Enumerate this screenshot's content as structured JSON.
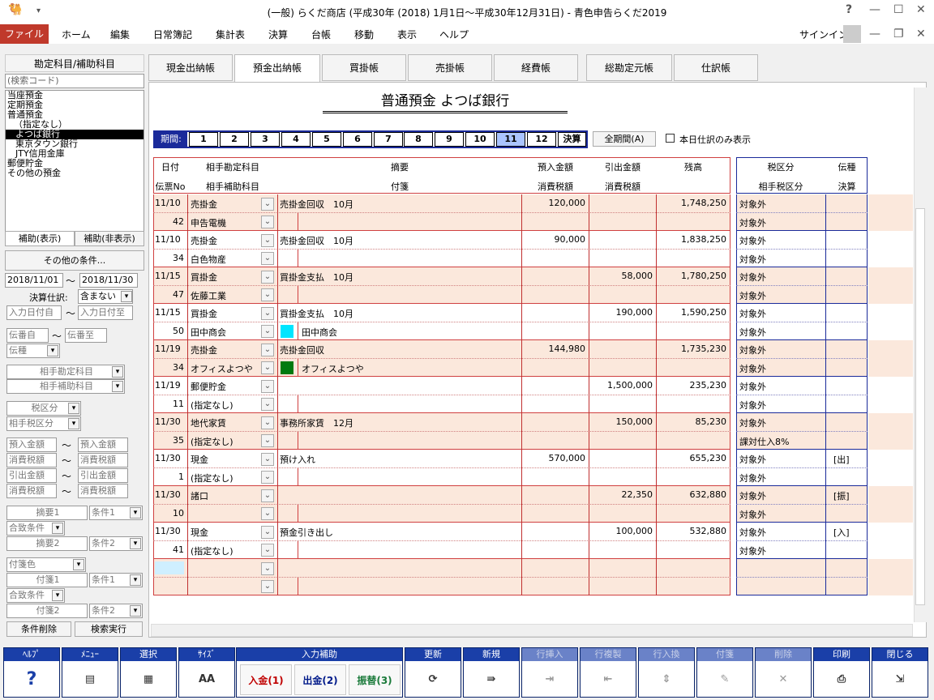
{
  "window": {
    "title": "(一般) らくだ商店 (平成30年 (2018) 1月1日〜平成30年12月31日) - 青色申告らくだ2019",
    "help_label": "?",
    "signin_label": "サインイン"
  },
  "menu": [
    "ファイル",
    "ホーム",
    "編集",
    "日常簿記",
    "集計表",
    "決算",
    "台帳",
    "移動",
    "表示",
    "ヘルプ"
  ],
  "left": {
    "header": "勘定科目/補助科目",
    "search_placeholder": "(検索コード)",
    "tree": [
      "当座預金",
      "定期預金",
      "普通預金",
      "（指定なし）",
      "よつば銀行",
      "東京タウン銀行",
      "JTY信用金庫",
      "郵便貯金",
      "その他の預金"
    ],
    "tab_show": "補助(表示)",
    "tab_hide": "補助(非表示)",
    "other_cond": "その他の条件...",
    "date_from": "2018/11/01",
    "date_to": "2018/11/30",
    "tilde": "〜",
    "kessan_label": "決算仕訳:",
    "kessan_value": "含まない",
    "input_from": "入力日付自",
    "input_to": "入力日付至",
    "denban_from": "伝番自",
    "denban_to": "伝番至",
    "denshu": "伝種",
    "aite_kamoku": "相手勘定科目",
    "aite_hojo": "相手補助科目",
    "zeikubun": "税区分",
    "aite_zei": "相手税区分",
    "azuke_from": "預入金額",
    "azuke_to": "預入金額",
    "shohi1_from": "消費税額",
    "shohi1_to": "消費税額",
    "hiki_from": "引出金額",
    "hiki_to": "引出金額",
    "shohi2_from": "消費税額",
    "shohi2_to": "消費税額",
    "tekiyo1": "摘要1",
    "joken1": "条件1",
    "goitchi1": "合致条件",
    "tekiyo2": "摘要2",
    "joken2": "条件2",
    "fusen_color": "付箋色",
    "fusen1": "付箋1",
    "fjoken1": "条件1",
    "goitchi2": "合致条件",
    "fusen2": "付箋2",
    "fjoken2": "条件2",
    "clear_btn": "条件削除",
    "search_btn": "検索実行"
  },
  "tabs": [
    "現金出納帳",
    "預金出納帳",
    "買掛帳",
    "売掛帳",
    "経費帳",
    "総勘定元帳",
    "仕訳帳"
  ],
  "ledger": {
    "title": "普通預金 よつば銀行",
    "period_label": "期間:",
    "periods": [
      "1",
      "2",
      "3",
      "4",
      "5",
      "6",
      "7",
      "8",
      "9",
      "10",
      "11",
      "12",
      "決算"
    ],
    "all_period": "全期間(A)",
    "today_only": "本日仕訳のみ表示",
    "headers": {
      "date": "日付",
      "denno": "伝票No",
      "aite": "相手勘定科目",
      "aite_hojo": "相手補助科目",
      "tekiyo": "摘要",
      "fusen": "付箋",
      "azuke": "預入金額",
      "azuke_tax": "消費税額",
      "hiki": "引出金額",
      "hiki_tax": "消費税額",
      "zandaka": "残高",
      "zei": "税区分",
      "aite_zei": "相手税区分",
      "denshu": "伝種",
      "kessan": "決算"
    },
    "rows": [
      {
        "date": "11/10",
        "no": "42",
        "kamoku": "売掛金",
        "hojo": "申告電機",
        "tekiyo": "売掛金回収　10月",
        "fusen": "",
        "azuke": "120,000",
        "hiki": "",
        "zandaka": "1,748,250",
        "zei": "対象外",
        "aite_zei": "対象外",
        "denshu": ""
      },
      {
        "date": "11/10",
        "no": "34",
        "kamoku": "売掛金",
        "hojo": "白色物産",
        "tekiyo": "売掛金回収　10月",
        "fusen": "",
        "azuke": "90,000",
        "hiki": "",
        "zandaka": "1,838,250",
        "zei": "対象外",
        "aite_zei": "対象外",
        "denshu": ""
      },
      {
        "date": "11/15",
        "no": "47",
        "kamoku": "買掛金",
        "hojo": "佐藤工業",
        "tekiyo": "買掛金支払　10月",
        "fusen": "",
        "azuke": "",
        "hiki": "58,000",
        "zandaka": "1,780,250",
        "zei": "対象外",
        "aite_zei": "対象外",
        "denshu": ""
      },
      {
        "date": "11/15",
        "no": "50",
        "kamoku": "買掛金",
        "hojo": "田中商会",
        "tekiyo": "買掛金支払　10月",
        "fusen": "田中商会",
        "fcolor": "#00e5ff",
        "azuke": "",
        "hiki": "190,000",
        "zandaka": "1,590,250",
        "zei": "対象外",
        "aite_zei": "対象外",
        "denshu": ""
      },
      {
        "date": "11/19",
        "no": "34",
        "kamoku": "売掛金",
        "hojo": "オフィスよつや",
        "tekiyo": "売掛金回収",
        "fusen": "オフィスよつや",
        "fcolor": "#007a10",
        "azuke": "144,980",
        "hiki": "",
        "zandaka": "1,735,230",
        "zei": "対象外",
        "aite_zei": "対象外",
        "denshu": ""
      },
      {
        "date": "11/19",
        "no": "11",
        "kamoku": "郵便貯金",
        "hojo": "(指定なし)",
        "tekiyo": "",
        "fusen": "",
        "azuke": "",
        "hiki": "1,500,000",
        "zandaka": "235,230",
        "zei": "対象外",
        "aite_zei": "対象外",
        "denshu": ""
      },
      {
        "date": "11/30",
        "no": "35",
        "kamoku": "地代家賃",
        "hojo": "(指定なし)",
        "tekiyo": "事務所家賃　12月",
        "fusen": "",
        "azuke": "",
        "hiki": "150,000",
        "zandaka": "85,230",
        "zei": "対象外",
        "aite_zei": "課対仕入8%",
        "denshu": ""
      },
      {
        "date": "11/30",
        "no": "1",
        "kamoku": "現金",
        "hojo": "(指定なし)",
        "tekiyo": "預け入れ",
        "fusen": "",
        "azuke": "570,000",
        "hiki": "",
        "zandaka": "655,230",
        "zei": "対象外",
        "aite_zei": "対象外",
        "denshu": "[出]"
      },
      {
        "date": "11/30",
        "no": "10",
        "kamoku": "諸口",
        "hojo": "",
        "tekiyo": "",
        "fusen": "",
        "azuke": "",
        "hiki": "22,350",
        "zandaka": "632,880",
        "zei": "対象外",
        "aite_zei": "対象外",
        "denshu": "[振]"
      },
      {
        "date": "11/30",
        "no": "41",
        "kamoku": "現金",
        "hojo": "(指定なし)",
        "tekiyo": "預金引き出し",
        "fusen": "",
        "azuke": "",
        "hiki": "100,000",
        "zandaka": "532,880",
        "zei": "対象外",
        "aite_zei": "対象外",
        "denshu": "[入]"
      }
    ]
  },
  "toolbar": [
    {
      "head": "ﾍﾙﾌﾟ",
      "label": "?",
      "enabled": true
    },
    {
      "head": "ﾒﾆｭｰ",
      "label": "",
      "enabled": true
    },
    {
      "head": "選択",
      "label": "",
      "enabled": true
    },
    {
      "head": "ｻｲｽﾞ",
      "label": "AA",
      "enabled": true
    },
    {
      "head": "入力補助",
      "label": "",
      "enabled": true
    },
    {
      "head": "更新",
      "label": "",
      "enabled": true
    },
    {
      "head": "新規",
      "label": "",
      "enabled": true
    },
    {
      "head": "行挿入",
      "label": "",
      "enabled": false
    },
    {
      "head": "行複製",
      "label": "",
      "enabled": false
    },
    {
      "head": "行入換",
      "label": "",
      "enabled": false
    },
    {
      "head": "付箋",
      "label": "",
      "enabled": false
    },
    {
      "head": "削除",
      "label": "",
      "enabled": false
    },
    {
      "head": "印刷",
      "label": "",
      "enabled": true
    },
    {
      "head": "閉じる",
      "label": "",
      "enabled": true
    }
  ],
  "assist": {
    "nyukin": "入金(1)",
    "shukkin": "出金(2)",
    "furikae": "振替(3)"
  }
}
